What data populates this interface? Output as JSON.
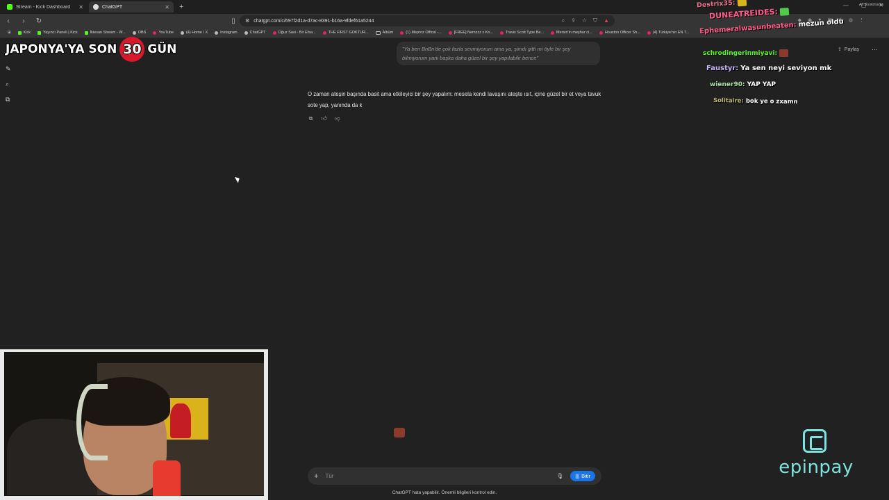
{
  "browser": {
    "tabs": [
      {
        "title": "Stream - Kick Dashboard",
        "active": false
      },
      {
        "title": "ChatGPT",
        "active": true
      }
    ],
    "new_tab": "+",
    "url": "chatgpt.com/c/697f2d1a-d7ac-8391-b16a-9fdef61a5244",
    "bookmarks": [
      {
        "label": "Kick",
        "icon": "kick"
      },
      {
        "label": "Yayıncı Paneli | Kick",
        "icon": "kick"
      },
      {
        "label": "İkiesan Stream - W...",
        "icon": "kick"
      },
      {
        "label": "OBS",
        "icon": "globe"
      },
      {
        "label": "YouTube",
        "icon": "youtube"
      },
      {
        "label": "(4) Home / X",
        "icon": "x"
      },
      {
        "label": "Instagram",
        "icon": "instagram"
      },
      {
        "label": "ChatGPT",
        "icon": "globe"
      },
      {
        "label": "Oğuz Sasi - Bir Efsa...",
        "icon": "youtube"
      },
      {
        "label": "THE FIRST GOKTUR...",
        "icon": "youtube"
      },
      {
        "label": "Albüm",
        "icon": "folder"
      },
      {
        "label": "(1) Meproz Offical -...",
        "icon": "youtube"
      },
      {
        "label": "[FREE] Nemzzz x Kn...",
        "icon": "youtube"
      },
      {
        "label": "Travis Scott Type Be...",
        "icon": "youtube"
      },
      {
        "label": "Mersin'in meşhur ci...",
        "icon": "youtube"
      },
      {
        "label": "Houston Officer Sh...",
        "icon": "youtube"
      },
      {
        "label": "(4) Türkiye'nin EN T...",
        "icon": "youtube"
      }
    ],
    "all_bookmarks": "All Bookmarks"
  },
  "chat": {
    "share_label": "Paylaş",
    "user_quote": "\"Ya ben BnBn'de çok fazla sevmiyorum ama ya, şimdi gitti mi öyle bir şey bilmiyorum yani başka daha güzel bir şey yapılabilir bence\"",
    "assistant_text": "O zaman ateşin başında basit ama etkileyici bir şey yapalım: mesela kendi lavaşını ateşte ısıt, içine güzel bir et veya tavuk sote yap, yanında da k",
    "composer_placeholder": "Tür",
    "voice_button": "Bitir",
    "disclaimer": "ChatGPT hata yapabilir. Önemli bilgileri kontrol edin."
  },
  "overlay": {
    "countdown_prefix": "JAPONYA'YA SON",
    "countdown_number": "30",
    "countdown_suffix": "GÜN",
    "sponsor": "epinpay",
    "stream_chat": [
      {
        "user": "Destrix35:",
        "message": "",
        "user_color": "#e8708a"
      },
      {
        "user": "DUNEATREIDES:",
        "message": "",
        "user_color": "#ff5a8a"
      },
      {
        "user": "Ephemeralwasunbeaten:",
        "message": "mezun oldu",
        "user_color": "#ff5a8a"
      },
      {
        "user": "schrodingerinmiyavi:",
        "message": "",
        "user_color": "#53fc18"
      },
      {
        "user": "Faustyr:",
        "message": "Ya sen neyi seviyon mk",
        "user_color": "#c9b6ff"
      },
      {
        "user": "wiener90:",
        "message": "YAP YAP",
        "user_color": "#a6e3a1"
      },
      {
        "user": "Solitaire:",
        "message": "bok ye o zxamn",
        "user_color": "#bdb76b"
      }
    ]
  }
}
